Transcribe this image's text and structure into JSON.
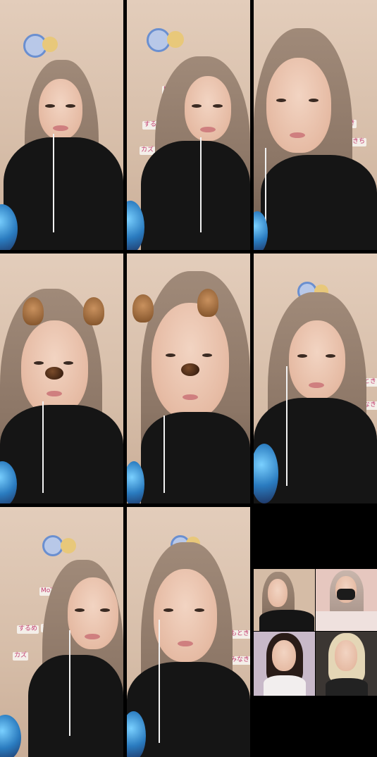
{
  "layout": {
    "columns": 3,
    "rows": 3
  },
  "tiles": [
    {
      "id": 1,
      "filter": "none"
    },
    {
      "id": 2,
      "filter": "none"
    },
    {
      "id": 3,
      "filter": "none"
    },
    {
      "id": 4,
      "filter": "dog-ears"
    },
    {
      "id": 5,
      "filter": "dog-ears"
    },
    {
      "id": 6,
      "filter": "none"
    },
    {
      "id": 7,
      "filter": "none"
    },
    {
      "id": 8,
      "filter": "none"
    }
  ],
  "notes": {
    "moto": "MoTo",
    "surume": "するめ",
    "saw": "さわ",
    "kazu": "カズ",
    "motoki": "もとき",
    "minaki": "みなきち"
  },
  "participants_panel": {
    "count": 4
  },
  "colors": {
    "background": "#000000",
    "wall": "#d9c3b1",
    "note_text": "#c23c6e"
  }
}
